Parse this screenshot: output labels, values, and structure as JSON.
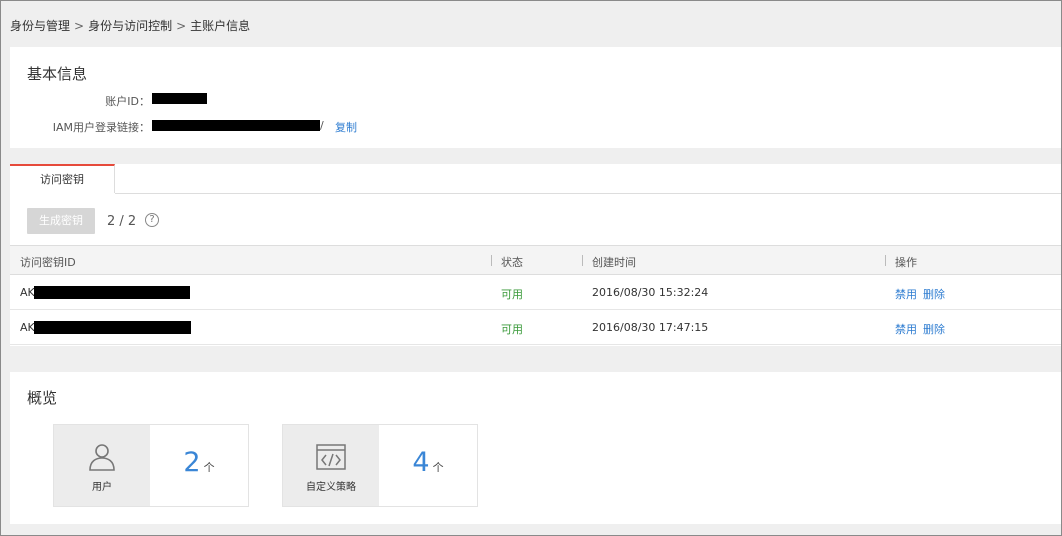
{
  "breadcrumb": {
    "items": [
      "身份与管理",
      "身份与访问控制",
      "主账户信息"
    ],
    "separator": ">"
  },
  "basic_info": {
    "title": "基本信息",
    "account_id_label": "账户ID：",
    "iam_link_label": "IAM用户登录链接：",
    "iam_link_suffix": "/",
    "copy_label": "复制"
  },
  "keys": {
    "tab_label": "访问密钥",
    "generate_button": "生成密钥",
    "count": "2 / 2",
    "help_symbol": "?",
    "columns": [
      "访问密钥ID",
      "状态",
      "创建时间",
      "操作"
    ],
    "rows": [
      {
        "id_prefix": "AK",
        "status": "可用",
        "created": "2016/08/30 15:32:24",
        "disable": "禁用",
        "delete": "删除"
      },
      {
        "id_prefix": "AK",
        "status": "可用",
        "created": "2016/08/30 17:47:15",
        "disable": "禁用",
        "delete": "删除"
      }
    ]
  },
  "overview": {
    "title": "概览",
    "cards": [
      {
        "label": "用户",
        "value": "2",
        "unit": "个",
        "icon": "user-icon"
      },
      {
        "label": "自定义策略",
        "value": "4",
        "unit": "个",
        "icon": "code-policy-icon"
      }
    ]
  },
  "colors": {
    "accent": "#2f7dd1",
    "status_ok": "#3a9a3a",
    "tab_active": "#e64a3b",
    "number": "#3a86d6"
  }
}
